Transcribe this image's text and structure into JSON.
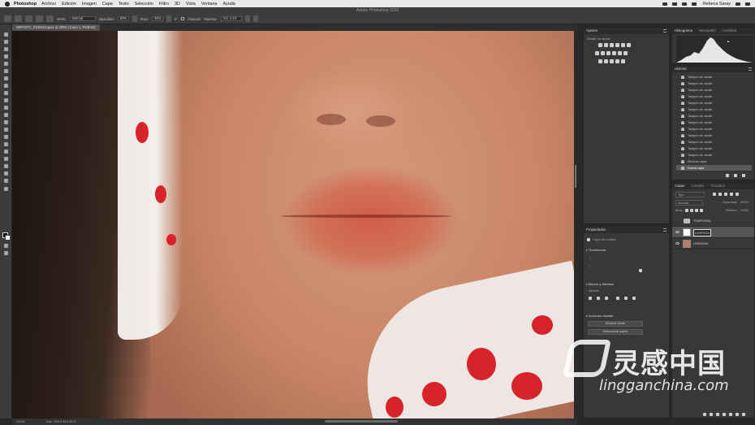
{
  "menubar": {
    "app_name": "Photoshop",
    "items": [
      "Archivo",
      "Edición",
      "Imagen",
      "Capa",
      "Texto",
      "Selección",
      "Filtro",
      "3D",
      "Vista",
      "Ventana",
      "Ayuda"
    ],
    "user": "Rebeca Saray"
  },
  "window": {
    "title": "Adobe Photoshop 2020"
  },
  "options": {
    "mode_label": "Modo:",
    "mode_value": "Normal",
    "opacity_label": "Opacidad:",
    "opacity_value": "80%",
    "flow_label": "Flujo:",
    "flow_value": "26%",
    "smoothing_label": "Suavizado:",
    "smoothing_value": "",
    "angle_value": "0°",
    "sample_label": "Muestra:",
    "sample_value": "Act. e inf.",
    "aligned_label": "Alineado"
  },
  "document": {
    "tab_label": "MRF2671_RGB33Capa1 al 200% (Capa 1, RGB/16)"
  },
  "statusbar": {
    "zoom": "200%",
    "doc_info": "Doc: 263,5 M/2,85 G"
  },
  "panels": {
    "adjustments": {
      "title": "Ajustes",
      "hint": "Añadir un ajuste"
    },
    "histogram": {
      "tabs": [
        "Histograma",
        "Navegador",
        "Cantidad"
      ]
    },
    "history": {
      "title": "Historia",
      "items": [
        "Tampón de clonar",
        "Tampón de clonar",
        "Tampón de clonar",
        "Tampón de clonar",
        "Tampón de clonar",
        "Tampón de clonar",
        "Tampón de clonar",
        "Tampón de clonar",
        "Tampón de clonar",
        "Tampón de clonar",
        "Tampón de clonar",
        "Tampón de clonar",
        "Tampón de clonar",
        "Eliminar capa",
        "Nueva capa"
      ]
    },
    "properties": {
      "title": "Propiedades",
      "layer_kind": "Capa de píxeles",
      "transform_label": "Transformar",
      "align_label": "Alinear y distribuir",
      "align_sub": "Alinear:",
      "quick_actions_label": "Acciones rápidas",
      "btn_remove_bg": "Eliminar fondo",
      "btn_select_subject": "Seleccionar sujeto"
    },
    "layers": {
      "tabs": [
        "Capas",
        "Canales",
        "Trazados"
      ],
      "filter_label": "Tipo",
      "blend_mode": "Normal",
      "opacity_label": "Opacidad:",
      "opacity_value": "100%",
      "lock_label": "Bloq.:",
      "fill_label": "Relleno:",
      "fill_value": "100%",
      "rows": [
        {
          "name": "TEMPORAL",
          "kind": "group"
        },
        {
          "name": "LIMPIEZA",
          "kind": "pixel"
        },
        {
          "name": "ORIGINAL",
          "kind": "pixel"
        }
      ]
    }
  },
  "watermark": {
    "main_text": "灵感中国",
    "sub_text": "lingganchina.com"
  },
  "colors": {
    "panel_bg": "#383838",
    "lip_red": "#d15a46",
    "scarf_red": "#d8232a",
    "skin": "#d4987a"
  }
}
